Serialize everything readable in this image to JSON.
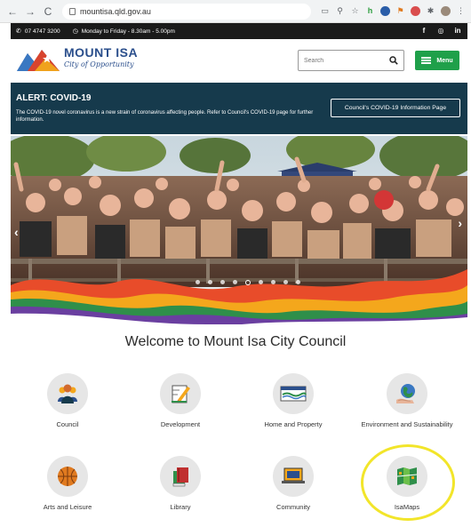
{
  "browser": {
    "url": "mountisa.qld.gov.au",
    "back": "←",
    "forward": "→",
    "reload": "C"
  },
  "topbar": {
    "phone": "07 4747 3200",
    "hours": "Monday to Friday - 8.30am - 5.00pm",
    "social": [
      "f",
      "◎",
      "in"
    ]
  },
  "header": {
    "logo_title": "MOUNT ISA",
    "logo_subtitle": "City of Opportunity",
    "search_placeholder": "Search",
    "menu_label": "Menu"
  },
  "alert": {
    "title": "ALERT: COVID-19",
    "text": "The COVID-19 novel coronavirus is a new strain of coronavirus affecting people. Refer to Council's COVID-19 page for further information.",
    "button": "Council's COVID-19 Information Page"
  },
  "hero": {
    "slide_count": 9,
    "active_slide": 5,
    "prev": "‹",
    "next": "›"
  },
  "welcome": "Welcome to Mount Isa City Council",
  "services": [
    {
      "label": "Council",
      "icon": "council-people-icon"
    },
    {
      "label": "Development",
      "icon": "development-pencil-icon"
    },
    {
      "label": "Home and Property",
      "icon": "home-property-icon"
    },
    {
      "label": "Environment and Sustainability",
      "icon": "environment-globe-icon"
    },
    {
      "label": "Arts and Leisure",
      "icon": "basketball-icon"
    },
    {
      "label": "Library",
      "icon": "library-books-icon"
    },
    {
      "label": "Community",
      "icon": "community-laptop-icon"
    },
    {
      "label": "IsaMaps",
      "icon": "map-icon"
    }
  ],
  "colors": {
    "alert_bg": "#163a4c",
    "menu_green": "#1fa04a",
    "brand_blue": "#2b4f8c",
    "highlight": "#f2e52a"
  }
}
